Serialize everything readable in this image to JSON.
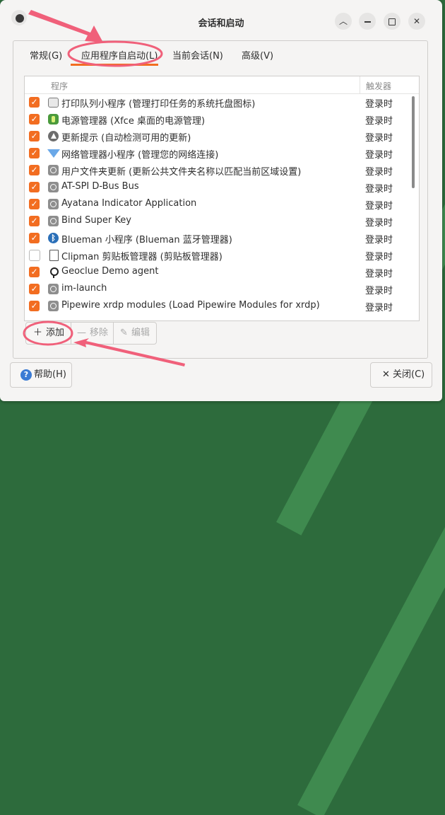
{
  "window": {
    "title": "会话和启动"
  },
  "tabs": [
    {
      "label": "常规(G)"
    },
    {
      "label": "应用程序自启动(L)"
    },
    {
      "label": "当前会话(N)"
    },
    {
      "label": "高级(V)"
    }
  ],
  "list": {
    "col_program": "程序",
    "col_trigger": "触发器",
    "rows": [
      {
        "checked": true,
        "icon": "printer-icon",
        "label": "打印队列小程序 (管理打印任务的系统托盘图标)",
        "trigger": "登录时"
      },
      {
        "checked": true,
        "icon": "power-manager-icon",
        "label": "电源管理器 (Xfce 桌面的电源管理)",
        "trigger": "登录时"
      },
      {
        "checked": true,
        "icon": "update-icon",
        "label": "更新提示 (自动检测可用的更新)",
        "trigger": "登录时"
      },
      {
        "checked": true,
        "icon": "wifi-icon",
        "label": "网络管理器小程序 (管理您的网络连接)",
        "trigger": "登录时"
      },
      {
        "checked": true,
        "icon": "app-generic-icon",
        "label": "用户文件夹更新 (更新公共文件夹名称以匹配当前区域设置)",
        "trigger": "登录时"
      },
      {
        "checked": true,
        "icon": "app-generic-icon",
        "label": "AT-SPI D-Bus Bus",
        "trigger": "登录时"
      },
      {
        "checked": true,
        "icon": "app-generic-icon",
        "label": "Ayatana Indicator Application",
        "trigger": "登录时"
      },
      {
        "checked": true,
        "icon": "app-generic-icon",
        "label": "Bind Super Key",
        "trigger": "登录时"
      },
      {
        "checked": true,
        "icon": "bluetooth-icon",
        "label": "Blueman 小程序 (Blueman 蓝牙管理器)",
        "trigger": "登录时"
      },
      {
        "checked": false,
        "icon": "clipboard-icon",
        "label": "Clipman 剪贴板管理器 (剪贴板管理器)",
        "trigger": "登录时"
      },
      {
        "checked": true,
        "icon": "location-pin-icon",
        "label": "Geoclue Demo agent",
        "trigger": "登录时"
      },
      {
        "checked": true,
        "icon": "app-generic-icon",
        "label": "im-launch",
        "trigger": "登录时"
      },
      {
        "checked": true,
        "icon": "app-generic-icon",
        "label": "Pipewire xrdp modules (Load Pipewire Modules for xrdp)",
        "trigger": "登录时"
      }
    ]
  },
  "toolbar": {
    "add_label": "添加",
    "remove_label": "移除",
    "edit_label": "编辑"
  },
  "footer": {
    "help_label": "帮助(H)",
    "close_label": "关闭(C)"
  },
  "colors": {
    "accent": "#f26d21",
    "annotation": "#f0607a"
  }
}
